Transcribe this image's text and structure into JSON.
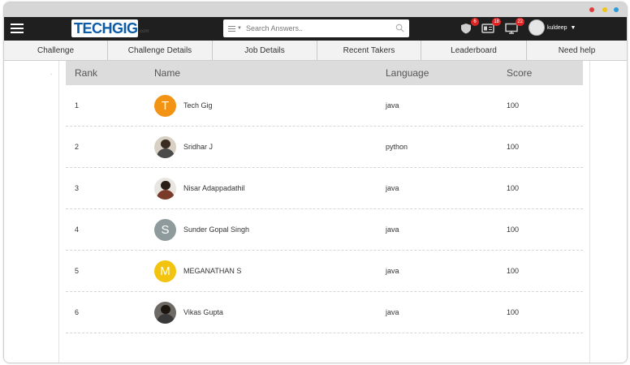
{
  "window": {
    "dots": [
      "#e23b3b",
      "#f0c419",
      "#2d9bd8"
    ]
  },
  "topbar": {
    "logo_text": "TECHGIG",
    "logo_domain": ".com",
    "search_placeholder": "Search Answers..",
    "notifications": [
      {
        "icon": "shield-icon",
        "count": "6"
      },
      {
        "icon": "id-card-icon",
        "count": "18"
      },
      {
        "icon": "monitor-icon",
        "count": "22"
      }
    ],
    "user_name": "kuldeep",
    "accent": "#0b5ca8"
  },
  "tabs": [
    {
      "label": "Challenge"
    },
    {
      "label": "Challenge Details"
    },
    {
      "label": "Job Details"
    },
    {
      "label": "Recent Takers"
    },
    {
      "label": "Leaderboard"
    },
    {
      "label": "Need help"
    }
  ],
  "leaderboard": {
    "tick": ".",
    "columns": {
      "rank": "Rank",
      "name": "Name",
      "language": "Language",
      "score": "Score"
    },
    "rows": [
      {
        "rank": "1",
        "initial": "T",
        "avatar_color": "#f39314",
        "name": "Tech Gig",
        "language": "java",
        "score": "100"
      },
      {
        "rank": "2",
        "initial": "",
        "avatar_color": "",
        "name": "Sridhar J",
        "language": "python",
        "score": "100"
      },
      {
        "rank": "3",
        "initial": "",
        "avatar_color": "",
        "name": "Nisar Adappadathil",
        "language": "java",
        "score": "100"
      },
      {
        "rank": "4",
        "initial": "S",
        "avatar_color": "#8e9a9b",
        "name": "Sunder Gopal Singh",
        "language": "java",
        "score": "100"
      },
      {
        "rank": "5",
        "initial": "M",
        "avatar_color": "#f2c40f",
        "name": "MEGANATHAN S",
        "language": "java",
        "score": "100"
      },
      {
        "rank": "6",
        "initial": "",
        "avatar_color": "",
        "name": "Vikas Gupta",
        "language": "java",
        "score": "100"
      }
    ]
  }
}
